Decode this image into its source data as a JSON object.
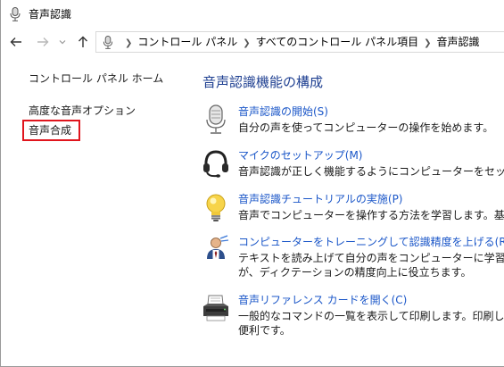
{
  "window": {
    "title": "音声認識"
  },
  "nav": {
    "back_icon": "arrow-left-icon",
    "forward_icon": "arrow-right-icon",
    "recent_icon": "chevron-down-icon",
    "up_icon": "arrow-up-icon"
  },
  "address": {
    "crumbs": [
      "コントロール パネル",
      "すべてのコントロール パネル項目",
      "音声認識"
    ]
  },
  "sidebar": {
    "home": "コントロール パネル ホーム",
    "advanced": "高度な音声オプション",
    "tts": "音声合成"
  },
  "main": {
    "heading": "音声認識機能の構成",
    "tasks": [
      {
        "link": "音声認識の開始(S)",
        "desc": [
          "自分の声を使ってコンピューターの操作を始めます。"
        ]
      },
      {
        "link": "マイクのセットアップ(M)",
        "desc": [
          "音声認識が正しく機能するようにコンピューターをセットアップします"
        ]
      },
      {
        "link": "音声認識チュートリアルの実施(P)",
        "desc": [
          "音声でコンピューターを操作する方法を学習します。基本的なコマ"
        ]
      },
      {
        "link": "コンピューターをトレーニングして認識精度を上げる(R)",
        "desc": [
          "テキストを読み上げて自分の声をコンピューターに学習させ、認識率",
          "が、ディクテーションの精度向上に役立ちます。"
        ]
      },
      {
        "link": "音声リファレンス カードを開く(C)",
        "desc": [
          "一般的なコマンドの一覧を表示して印刷します。印刷した一覧を手",
          "便利です。"
        ]
      }
    ]
  },
  "colors": {
    "link": "#1a56c8",
    "heading": "#1e3f91",
    "highlight": "#e0151d"
  }
}
